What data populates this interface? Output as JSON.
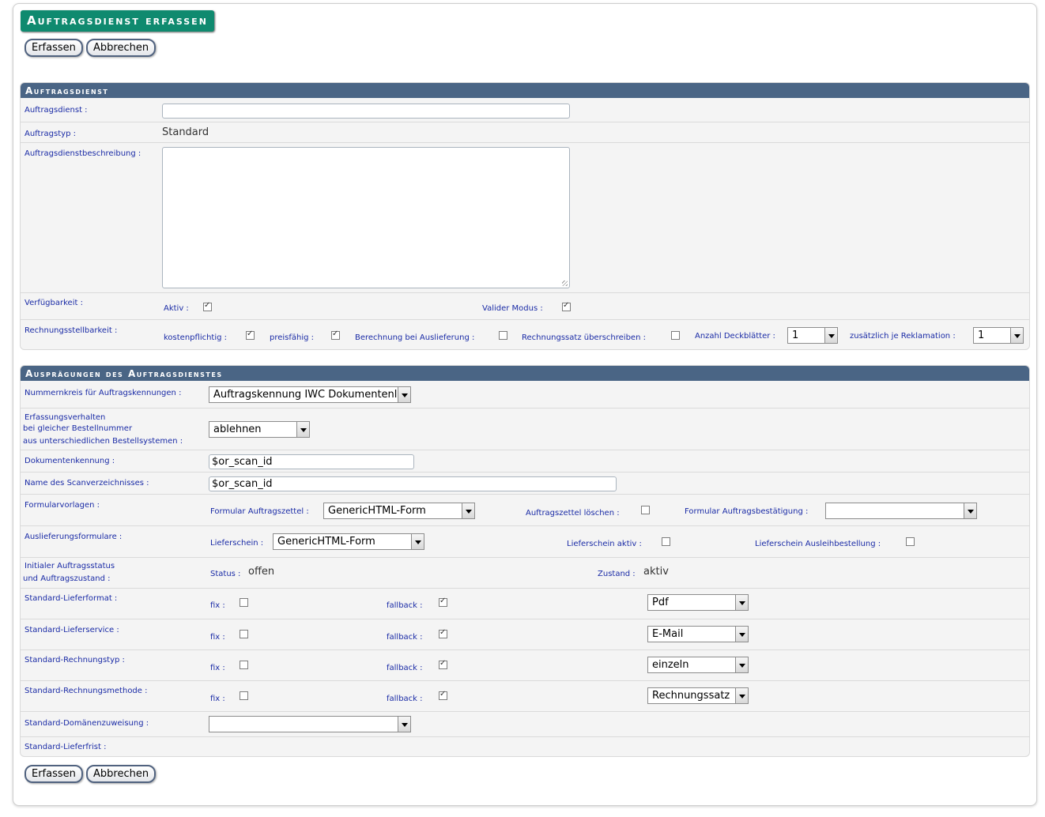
{
  "page": {
    "title": "Auftragsdienst erfassen"
  },
  "toolbar": {
    "submit_label": "Erfassen",
    "cancel_label": "Abbrechen"
  },
  "section1": {
    "title": "Auftragsdienst",
    "auftragsdienst": {
      "label": "Auftragsdienst :",
      "value": ""
    },
    "auftragstyp": {
      "label": "Auftragstyp :",
      "value": "Standard"
    },
    "beschreibung": {
      "label": "Auftragsdienstbeschreibung :",
      "value": ""
    },
    "verfuegbarkeit": {
      "label": "Verfügbarkeit :",
      "aktiv_label": "Aktiv :",
      "aktiv_checked": true,
      "valider_label": "Valider Modus :",
      "valider_checked": true
    },
    "rechnung": {
      "label": "Rechnungsstellbarkeit :",
      "kostenpflichtig_label": "kostenpflichtig :",
      "kostenpflichtig_checked": true,
      "preisfaehig_label": "preisfähig :",
      "preisfaehig_checked": true,
      "berechnung_label": "Berechnung bei Auslieferung :",
      "berechnung_checked": false,
      "ueberschreiben_label": "Rechnungssatz überschreiben :",
      "ueberschreiben_checked": false,
      "deckblaetter_label": "Anzahl Deckblätter :",
      "deckblaetter_value": "1",
      "reklamation_label": "zusätzlich je Reklamation :",
      "reklamation_value": "1"
    }
  },
  "section2": {
    "title": "Ausprägungen des Auftragsdienstes",
    "nummernkreis": {
      "label": "Nummernkreis für Auftragskennungen :",
      "value": "Auftragskennung IWC Dokumentenl"
    },
    "erfassung": {
      "label_l1": "Erfassungsverhalten",
      "label_l2": "bei gleicher Bestellnummer",
      "label_l3": "aus unterschiedlichen Bestellsystemen :",
      "value": "ablehnen"
    },
    "dokumentenkennung": {
      "label": "Dokumentenkennung :",
      "value": "$or_scan_id"
    },
    "scanverzeichnis": {
      "label": "Name des Scanverzeichnisses :",
      "value": "$or_scan_id"
    },
    "formularvorlagen": {
      "label": "Formularvorlagen :",
      "zettel_label": "Formular Auftragszettel :",
      "zettel_value": "GenericHTML-Form",
      "loeschen_label": "Auftragszettel löschen :",
      "loeschen_checked": false,
      "bestaetigung_label": "Formular Auftragsbestätigung :",
      "bestaetigung_value": ""
    },
    "auslieferung": {
      "label": "Auslieferungsformulare :",
      "lieferschein_label": "Lieferschein :",
      "lieferschein_value": "GenericHTML-Form",
      "aktiv_label": "Lieferschein aktiv :",
      "aktiv_checked": false,
      "ausleih_label": "Lieferschein Ausleihbestellung :",
      "ausleih_checked": false
    },
    "initial": {
      "label_l1": "Initialer Auftragsstatus",
      "label_l2": "und Auftragszustand :",
      "status_label": "Status :",
      "status_value": "offen",
      "zustand_label": "Zustand :",
      "zustand_value": "aktiv"
    },
    "defaults": [
      {
        "label": "Standard-Lieferformat :",
        "fix_label": "fix :",
        "fix_checked": false,
        "fallback_label": "fallback :",
        "fallback_checked": true,
        "value": "Pdf"
      },
      {
        "label": "Standard-Lieferservice :",
        "fix_label": "fix :",
        "fix_checked": false,
        "fallback_label": "fallback :",
        "fallback_checked": true,
        "value": "E-Mail"
      },
      {
        "label": "Standard-Rechnungstyp :",
        "fix_label": "fix :",
        "fix_checked": false,
        "fallback_label": "fallback :",
        "fallback_checked": true,
        "value": "einzeln"
      },
      {
        "label": "Standard-Rechnungsmethode :",
        "fix_label": "fix :",
        "fix_checked": false,
        "fallback_label": "fallback :",
        "fallback_checked": true,
        "value": "Rechnungssatz"
      }
    ],
    "domaene": {
      "label": "Standard-Domänenzuweisung :",
      "value": ""
    },
    "lieferfrist": {
      "label": "Standard-Lieferfrist :"
    }
  }
}
